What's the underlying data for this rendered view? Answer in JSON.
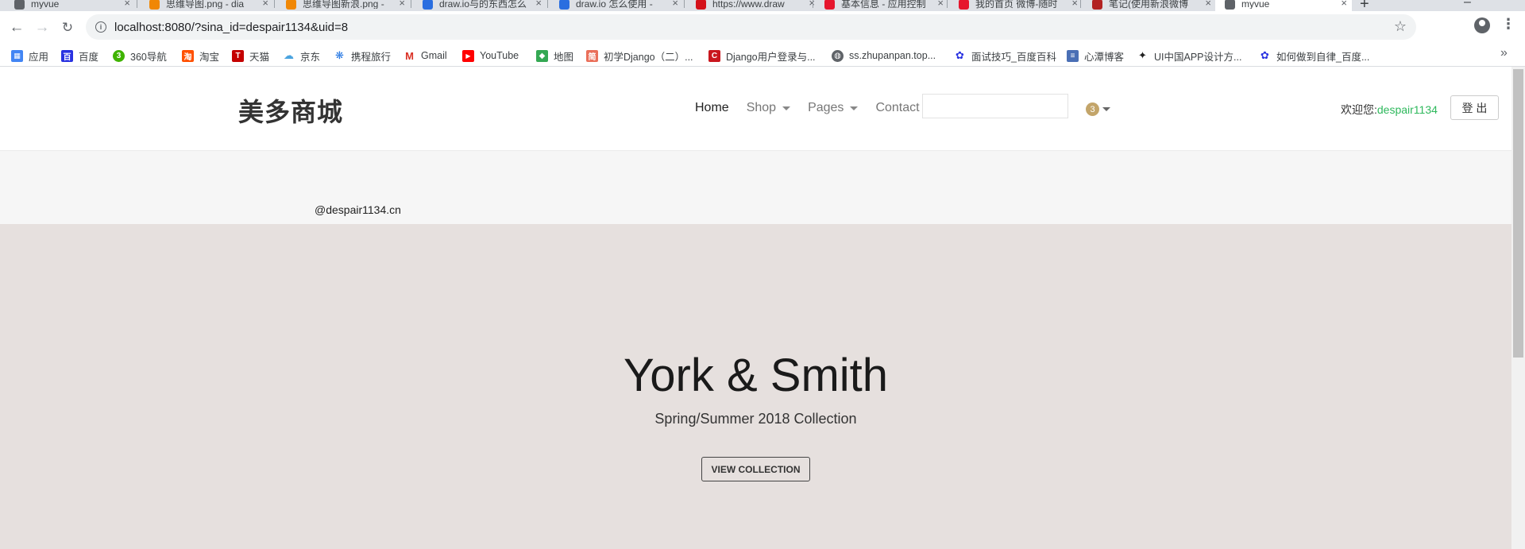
{
  "browser": {
    "tabs": [
      {
        "title": "myvue",
        "favicon_color": "#5f6368"
      },
      {
        "title": "思维导图.png - dia",
        "favicon_color": "#f08705"
      },
      {
        "title": "思维导图新浪.png -",
        "favicon_color": "#f08705"
      },
      {
        "title": "draw.io与的东西怎么",
        "favicon_color": "#2a6ee0"
      },
      {
        "title": "draw.io 怎么使用 - ",
        "favicon_color": "#2a6ee0"
      },
      {
        "title": "https://www.draw",
        "favicon_color": "#d4111a"
      },
      {
        "title": "基本信息 - 应用控制",
        "favicon_color": "#e6162d"
      },
      {
        "title": "我的首页 微博-随时",
        "favicon_color": "#e6162d"
      },
      {
        "title": "笔记(使用新浪微博",
        "favicon_color": "#b22222"
      },
      {
        "title": "myvue",
        "favicon_color": "#5f6368",
        "active": true
      }
    ],
    "new_tab": "+",
    "url": "localhost:8080/?sina_id=despair1134&uid=8",
    "bookmarks": [
      {
        "label": "应用",
        "icon": "apps-grid-icon",
        "color": "#4285f4"
      },
      {
        "label": "百度",
        "icon": "baidu-icon",
        "color": "#2932e1"
      },
      {
        "label": "360导航",
        "icon": "360-icon",
        "color": "#3fb300"
      },
      {
        "label": "淘宝",
        "icon": "taobao-icon",
        "color": "#ff5000"
      },
      {
        "label": "天猫",
        "icon": "tmall-icon",
        "color": "#c40000"
      },
      {
        "label": "京东",
        "icon": "cloud-icon",
        "color": "#4aa3df"
      },
      {
        "label": "携程旅行",
        "icon": "ctrip-icon",
        "color": "#2577e3"
      },
      {
        "label": "Gmail",
        "icon": "gmail-icon",
        "color": "#d93025"
      },
      {
        "label": "YouTube",
        "icon": "youtube-icon",
        "color": "#ff0000"
      },
      {
        "label": "地图",
        "icon": "maps-icon",
        "color": "#34a853"
      },
      {
        "label": "初学Django（二）...",
        "icon": "jianshu-icon",
        "color": "#ea6f5a"
      },
      {
        "label": "Django用户登录与...",
        "icon": "csdn-icon",
        "color": "#c9171e"
      },
      {
        "label": "ss.zhupanpan.top...",
        "icon": "globe-icon",
        "color": "#5f6368"
      },
      {
        "label": "面试技巧_百度百科",
        "icon": "baidu-paw-icon",
        "color": "#2932e1"
      },
      {
        "label": "心潭博客",
        "icon": "doc-icon",
        "color": "#4a6fb5"
      },
      {
        "label": "UI中国APP设计方...",
        "icon": "ui-china-icon",
        "color": "#222222"
      },
      {
        "label": "如何做到自律_百度...",
        "icon": "baidu-paw-icon",
        "color": "#2932e1"
      }
    ],
    "more": "»"
  },
  "header": {
    "logo": "美多商城",
    "nav": [
      {
        "label": "Home",
        "active": true,
        "dropdown": false
      },
      {
        "label": "Shop",
        "active": false,
        "dropdown": true
      },
      {
        "label": "Pages",
        "active": false,
        "dropdown": true
      },
      {
        "label": "Contact",
        "active": false,
        "dropdown": false
      }
    ],
    "search_value": "",
    "cart_count": "3",
    "welcome_prefix": "欢迎您:",
    "username": "despair1134",
    "logout": "登 出"
  },
  "subbar": {
    "email": "@despair1134.cn"
  },
  "hero": {
    "title": "York & Smith",
    "subtitle": "Spring/Summer 2018 Collection",
    "button": "VIEW COLLECTION",
    "bg_color": "#e6e0de"
  }
}
